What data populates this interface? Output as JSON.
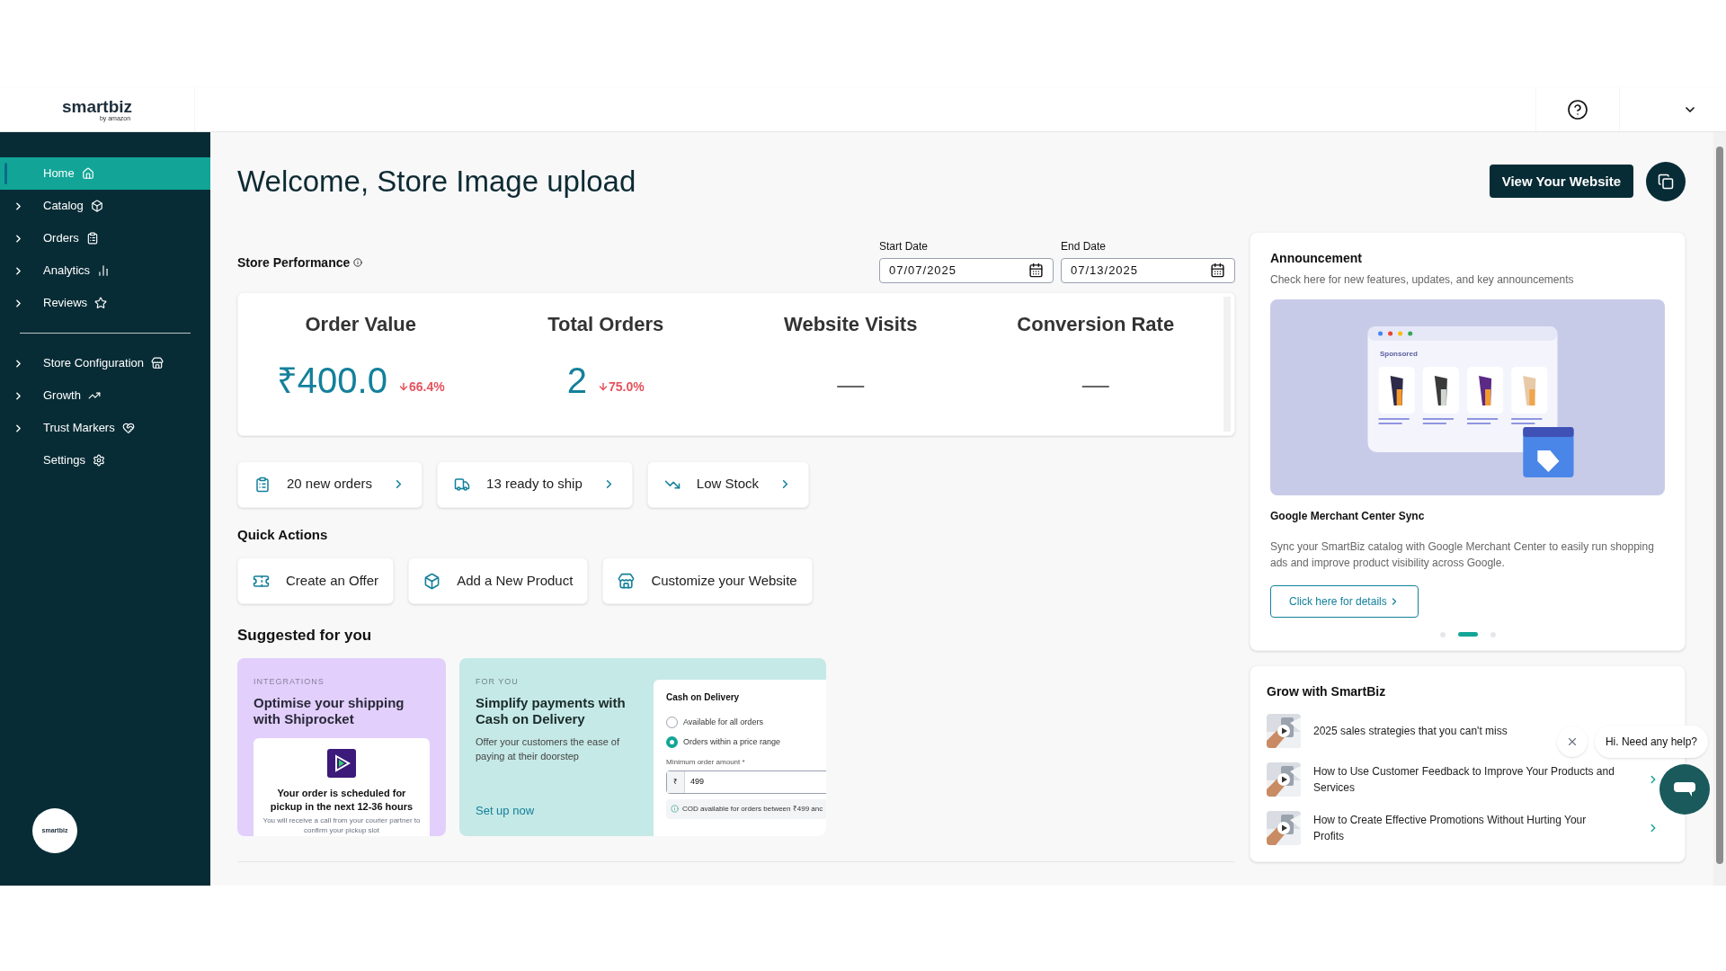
{
  "header": {
    "logo": "smartbiz",
    "logo_sub": "by amazon"
  },
  "sidebar": {
    "items": [
      {
        "kind": "item",
        "label": "Home",
        "expandable": false,
        "selected": true
      },
      {
        "kind": "item",
        "label": "Catalog",
        "expandable": true,
        "selected": false
      },
      {
        "kind": "item",
        "label": "Orders",
        "expandable": true,
        "selected": false
      },
      {
        "kind": "item",
        "label": "Analytics",
        "expandable": true,
        "selected": false
      },
      {
        "kind": "item",
        "label": "Reviews",
        "expandable": true,
        "selected": false
      },
      {
        "kind": "divider"
      },
      {
        "kind": "item",
        "label": "Store Configuration",
        "expandable": true,
        "selected": false
      },
      {
        "kind": "item",
        "label": "Growth",
        "expandable": true,
        "selected": false
      },
      {
        "kind": "item",
        "label": "Trust Markers",
        "expandable": true,
        "selected": false
      },
      {
        "kind": "item",
        "label": "Settings",
        "expandable": false,
        "selected": false
      }
    ],
    "badge_logo": "smartbiz"
  },
  "page": {
    "title": "Welcome, Store Image upload",
    "view_button": "View Your Website"
  },
  "performance": {
    "title": "Store Performance",
    "start_label": "Start Date",
    "start_value": "07/07/2025",
    "end_label": "End Date",
    "end_value": "07/13/2025",
    "metrics": [
      {
        "label": "Order Value",
        "value": "₹400.0",
        "change": "66.4%"
      },
      {
        "label": "Total Orders",
        "value": "2",
        "change": "75.0%"
      },
      {
        "label": "Website Visits",
        "value": "—"
      },
      {
        "label": "Conversion Rate",
        "value": "—"
      }
    ]
  },
  "shortcuts": [
    {
      "label": "20 new orders"
    },
    {
      "label": "13 ready to ship"
    },
    {
      "label": "Low Stock"
    }
  ],
  "quick_actions": {
    "title": "Quick Actions",
    "items": [
      {
        "label": "Create an Offer"
      },
      {
        "label": "Add a New Product"
      },
      {
        "label": "Customize your Website"
      }
    ]
  },
  "suggested": {
    "title": "Suggested for you",
    "shiprocket": {
      "tag": "INTEGRATIONS",
      "title": "Optimise your shipping with Shiprocket",
      "mock_title": "Your order is scheduled for pickup in the next 12-36 hours",
      "mock_text": "You will receive a call from your courier partner to confirm your pickup slot"
    },
    "cod": {
      "tag": "FOR YOU",
      "title": "Simplify payments with Cash on Delivery",
      "text": "Offer your customers the ease of paying at their doorstep",
      "link": "Set up now",
      "mock_title": "Cash on Delivery",
      "options": [
        {
          "label": "Available for all orders",
          "selected": false
        },
        {
          "label": "Orders within a price range",
          "selected": true
        }
      ],
      "amount_label": "Minimum order amount *",
      "currency": "₹",
      "amount": "499",
      "note": "COD available for orders between ₹499 anc"
    }
  },
  "announcement": {
    "title": "Announcement",
    "subtitle": "Check here for new features, updates, and key announcements",
    "picture_label": "Sponsored",
    "headline": "Google Merchant Center Sync",
    "text": "Sync your SmartBiz catalog with Google Merchant Center to easily run shopping ads and improve product visibility across Google.",
    "button": "Click here for details",
    "dots": [
      {
        "selected": false
      },
      {
        "selected": true
      },
      {
        "selected": false
      }
    ]
  },
  "grow": {
    "title": "Grow with SmartBiz",
    "items": [
      {
        "title": "2025 sales strategies that you can't miss"
      },
      {
        "title": "How to Use Customer Feedback to Improve Your Products and Services",
        "chevron": true
      },
      {
        "title": "How to Create Effective Promotions Without Hurting Your Profits",
        "chevron": true
      }
    ]
  },
  "chat": {
    "message": "Hi. Need any help?"
  }
}
